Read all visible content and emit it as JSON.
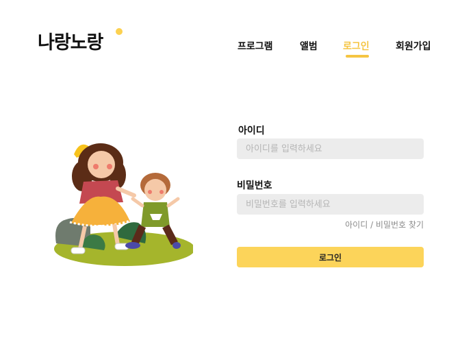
{
  "brand": {
    "logo_text": "나랑노랑"
  },
  "nav": {
    "items": [
      {
        "label": "프로그램"
      },
      {
        "label": "앨범"
      },
      {
        "label": "로그인",
        "active": true
      },
      {
        "label": "회원가입"
      }
    ]
  },
  "login_form": {
    "id_label": "아이디",
    "id_placeholder": "아이디를 입력하세요",
    "password_label": "비밀번호",
    "password_placeholder": "비밀번호를 입력하세요",
    "find_link": "아이디 / 비밀번호 찾기",
    "submit_label": "로그인"
  },
  "colors": {
    "accent": "#f5c542",
    "button_bg": "#fcd45a",
    "input_bg": "#ececec"
  }
}
